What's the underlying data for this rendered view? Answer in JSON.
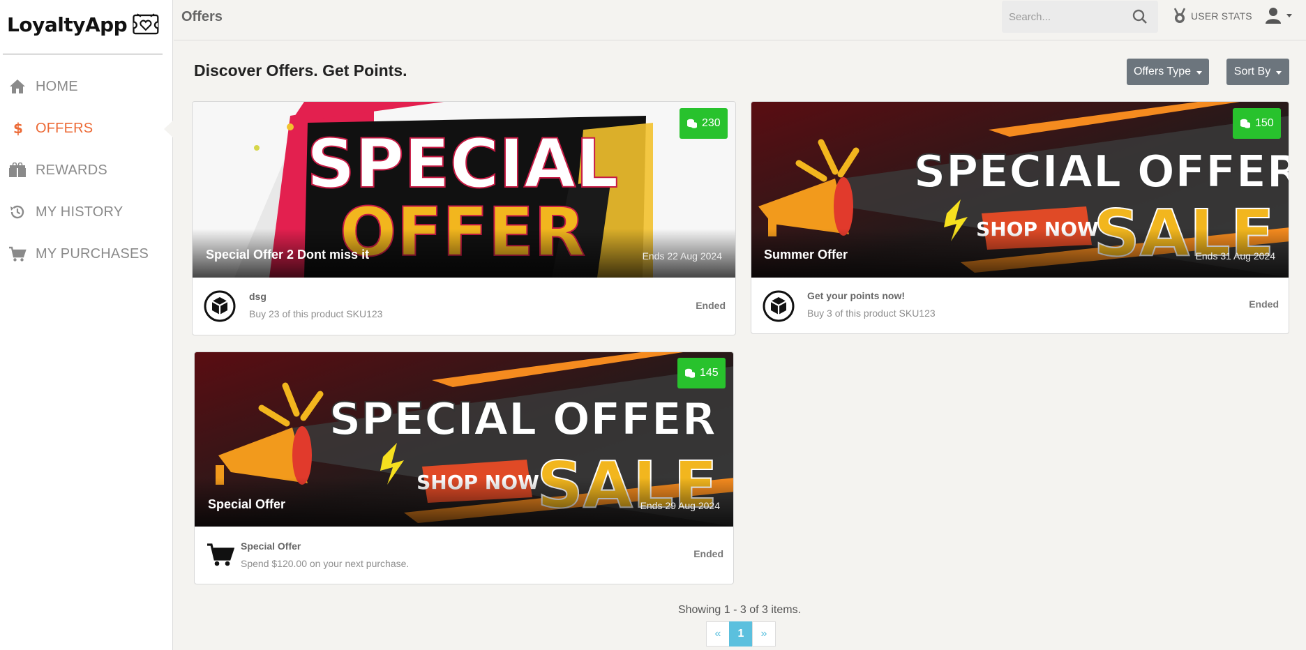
{
  "app": {
    "name": "LoyaltyApp"
  },
  "sidebar": {
    "items": [
      {
        "label": "HOME",
        "icon": "home-icon",
        "active": false
      },
      {
        "label": "OFFERS",
        "icon": "dollar-icon",
        "active": true
      },
      {
        "label": "REWARDS",
        "icon": "gift-icon",
        "active": false
      },
      {
        "label": "MY HISTORY",
        "icon": "history-icon",
        "active": false
      },
      {
        "label": "MY PURCHASES",
        "icon": "cart-icon",
        "active": false
      }
    ]
  },
  "header": {
    "title": "Offers",
    "search_placeholder": "Search...",
    "user_stats_label": "USER STATS"
  },
  "main": {
    "heading": "Discover Offers. Get Points.",
    "offers_type_label": "Offers Type",
    "sort_by_label": "Sort By"
  },
  "offers": [
    {
      "title": "Special Offer 2 Dont miss it",
      "ends": "Ends 22 Aug 2024",
      "points": "230",
      "footer_title": "dsg",
      "footer_desc": "Buy 23 of this product SKU123",
      "status": "Ended",
      "footer_icon": "box-icon",
      "banner_text": [
        "SPECIAL",
        "OFFER"
      ]
    },
    {
      "title": "Summer Offer",
      "ends": "Ends 31 Aug 2024",
      "points": "150",
      "footer_title": "Get your points now!",
      "footer_desc": "Buy 3 of this product SKU123",
      "status": "Ended",
      "footer_icon": "box-icon",
      "banner_text": [
        "SPECIAL OFFER",
        "SHOP NOW",
        "SALE"
      ]
    },
    {
      "title": "Special Offer",
      "ends": "Ends 29 Aug 2024",
      "points": "145",
      "footer_title": "Special Offer",
      "footer_desc": "Spend $120.00 on your next purchase.",
      "status": "Ended",
      "footer_icon": "cart-icon",
      "banner_text": [
        "SPECIAL OFFER",
        "SHOP NOW",
        "SALE"
      ]
    }
  ],
  "pagination": {
    "summary": "Showing 1 - 3 of 3 items.",
    "prev": "«",
    "current": "1",
    "next": "»"
  },
  "colors": {
    "accent": "#ec6a36",
    "badge_green": "#28c22d",
    "button_gray": "#6c757d",
    "pager_blue": "#5bc0de",
    "background": "#f4f3f0"
  }
}
